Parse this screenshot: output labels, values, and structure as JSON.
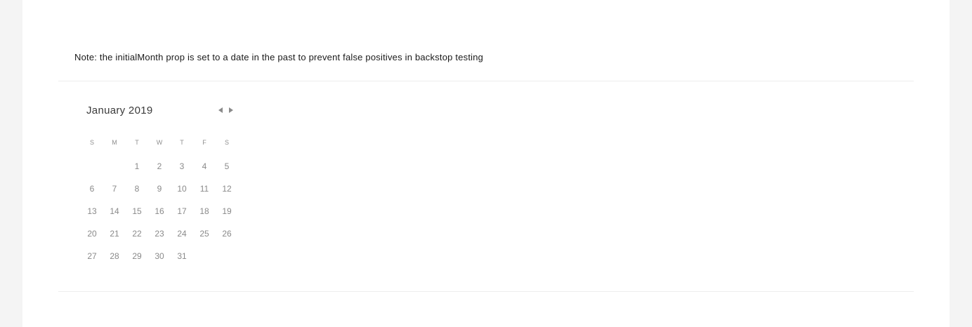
{
  "note": "Note: the initialMonth prop is set to a date in the past to prevent false positives in backstop testing",
  "calendar": {
    "month_label": "January 2019",
    "weekdays": [
      "S",
      "M",
      "T",
      "W",
      "T",
      "F",
      "S"
    ],
    "leading_blanks": 2,
    "days": [
      "1",
      "2",
      "3",
      "4",
      "5",
      "6",
      "7",
      "8",
      "9",
      "10",
      "11",
      "12",
      "13",
      "14",
      "15",
      "16",
      "17",
      "18",
      "19",
      "20",
      "21",
      "22",
      "23",
      "24",
      "25",
      "26",
      "27",
      "28",
      "29",
      "30",
      "31"
    ],
    "prev_icon": "triangle-left-icon",
    "next_icon": "triangle-right-icon"
  }
}
